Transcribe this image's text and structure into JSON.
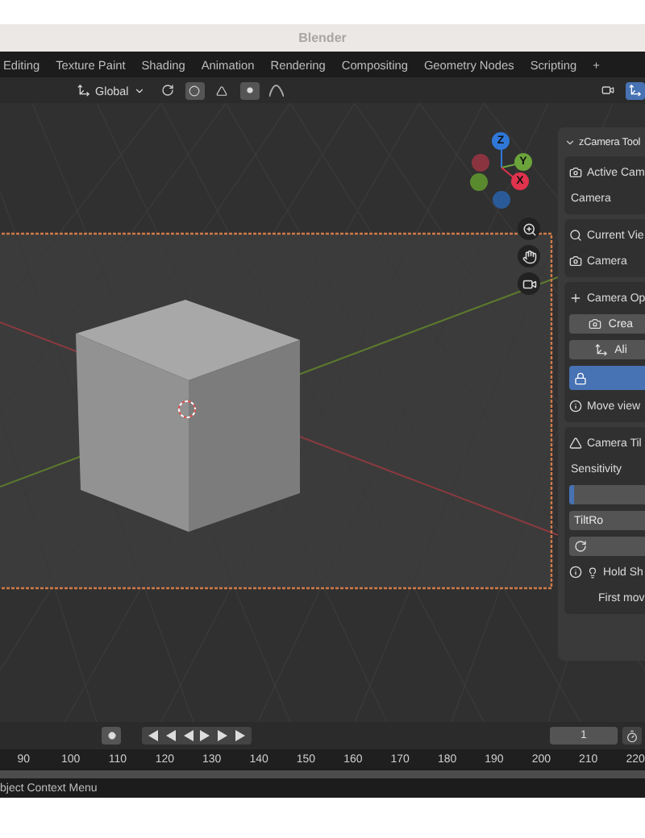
{
  "window": {
    "title": "Blender"
  },
  "workspace_tabs": [
    {
      "label": "Editing",
      "selected": false
    },
    {
      "label": "Texture Paint",
      "selected": false
    },
    {
      "label": "Shading",
      "selected": false
    },
    {
      "label": "Animation",
      "selected": false
    },
    {
      "label": "Rendering",
      "selected": false
    },
    {
      "label": "Compositing",
      "selected": false
    },
    {
      "label": "Geometry Nodes",
      "selected": false
    },
    {
      "label": "Scripting",
      "selected": false
    }
  ],
  "add_tab": "+",
  "header": {
    "orientation": "Global"
  },
  "gizmo_axes": [
    {
      "label": "Z",
      "color": "#2f78d8"
    },
    {
      "label": "Y",
      "color": "#6ca43c"
    },
    {
      "label": "X",
      "color": "#e0334e"
    }
  ],
  "panel": {
    "title": "zCamera Tool",
    "expanded": true,
    "boxes": [
      {
        "rows": [
          {
            "kind": "label",
            "text": "Active Cam"
          },
          {
            "kind": "text",
            "text": "Camera"
          }
        ]
      },
      {
        "rows": [
          {
            "kind": "label",
            "text": "Current Vie"
          },
          {
            "kind": "label",
            "text": "Camera"
          }
        ]
      },
      {
        "rows": [
          {
            "kind": "label",
            "text": "Camera Op"
          },
          {
            "kind": "button",
            "text": "Crea"
          },
          {
            "kind": "button",
            "text": "Ali"
          },
          {
            "kind": "toggle",
            "on": true
          },
          {
            "kind": "label",
            "text": "Move view"
          }
        ]
      },
      {
        "rows": [
          {
            "kind": "label",
            "text": "Camera Til"
          },
          {
            "kind": "text",
            "text": "Sensitivity"
          },
          {
            "kind": "slider",
            "level": 0.06
          },
          {
            "kind": "button",
            "text": "TiltRo"
          },
          {
            "kind": "icon_button"
          },
          {
            "kind": "label",
            "text": "Hold Sh"
          },
          {
            "kind": "text",
            "text": "First mov"
          }
        ]
      }
    ]
  },
  "timeline": {
    "frame": "1",
    "ruler": [
      "90",
      "100",
      "110",
      "120",
      "130",
      "140",
      "150",
      "160",
      "170",
      "180",
      "190",
      "200",
      "210",
      "220"
    ]
  },
  "status_bar": {
    "text": "bject Context Menu"
  }
}
